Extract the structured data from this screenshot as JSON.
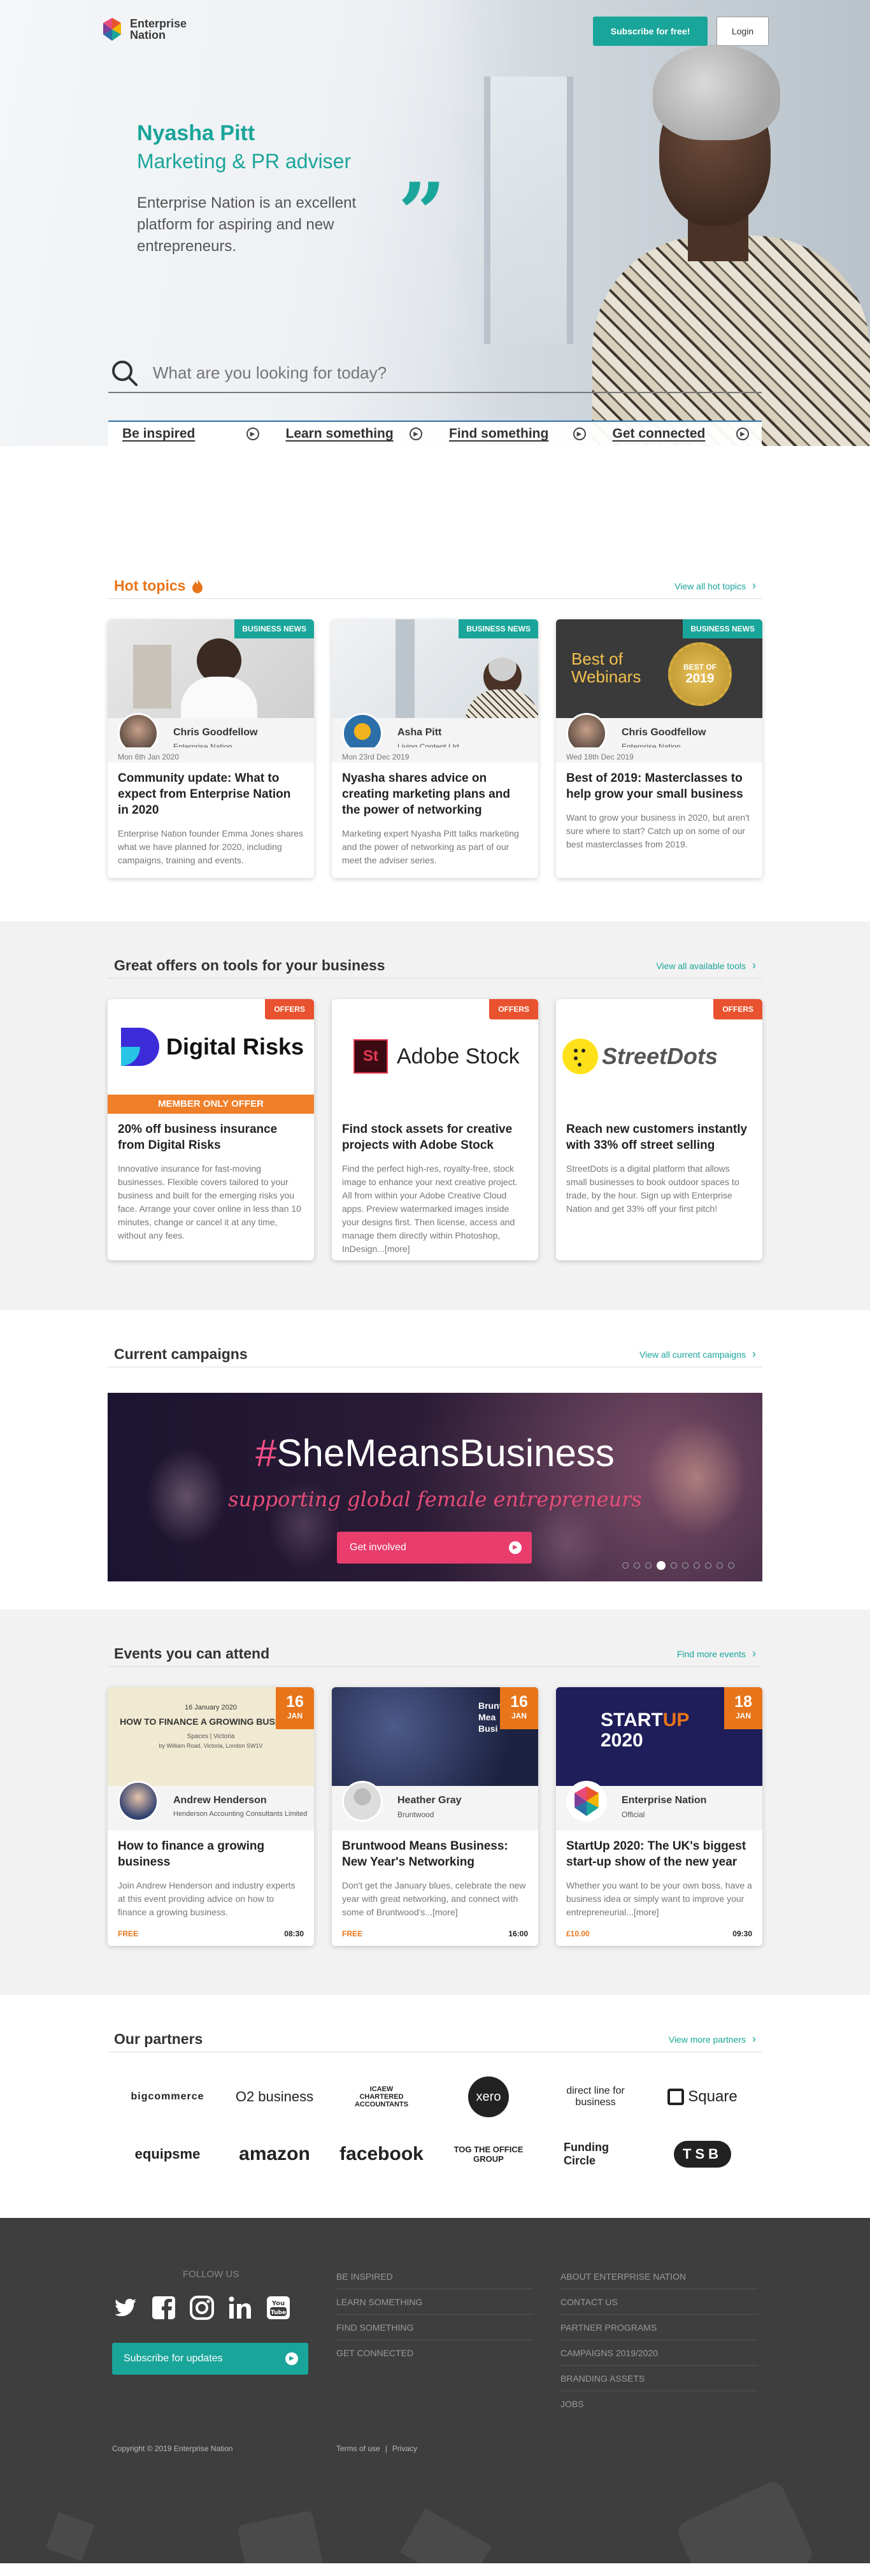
{
  "brand": {
    "name_line1": "Enterprise",
    "name_line2": "Nation"
  },
  "header": {
    "subscribe_label": "Subscribe for free!",
    "login_label": "Login"
  },
  "hero": {
    "name": "Nyasha Pitt",
    "role": "Marketing & PR adviser",
    "quote": "Enterprise Nation is an excellent platform for aspiring and new entrepreneurs.",
    "search_placeholder": "What are you looking for today?",
    "nav": [
      {
        "label": "Be inspired"
      },
      {
        "label": "Learn something"
      },
      {
        "label": "Find something"
      },
      {
        "label": "Get connected"
      }
    ]
  },
  "hot_topics": {
    "title": "Hot topics",
    "link": "View all hot topics",
    "cards": [
      {
        "tag": "BUSINESS NEWS",
        "author": "Chris Goodfellow",
        "org": "Enterprise Nation",
        "date": "Mon 6th Jan 2020",
        "title": "Community update: What to expect from Enterprise Nation in 2020",
        "desc": "Enterprise Nation founder Emma Jones shares what we have planned for 2020, including campaigns, training and events."
      },
      {
        "tag": "BUSINESS NEWS",
        "author": "Asha Pitt",
        "org": "Living Content Ltd",
        "date": "Mon 23rd Dec 2019",
        "title": "Nyasha shares advice on creating marketing plans and the power of networking",
        "desc": "Marketing expert Nyasha Pitt talks marketing and the power of networking as part of our meet the adviser series."
      },
      {
        "tag": "BUSINESS NEWS",
        "author": "Chris Goodfellow",
        "org": "Enterprise Nation",
        "date": "Wed 18th Dec 2019",
        "title": "Best of 2019: Masterclasses to help grow your small business",
        "desc": "Want to grow your business in 2020, but aren't sure where to start? Catch up on some of our best masterclasses from 2019.",
        "img_text_1": "Best of",
        "img_text_2": "Webinars",
        "seal_1": "BEST OF",
        "seal_2": "2019"
      }
    ]
  },
  "offers": {
    "title": "Great offers on tools for your business",
    "link": "View all available tools",
    "cards": [
      {
        "tag": "OFFERS",
        "brand": "Digital Risks",
        "band": "MEMBER ONLY OFFER",
        "title": "20% off business insurance from Digital Risks",
        "desc": "Innovative insurance for fast-moving businesses. Flexible covers tailored to your business and built for the emerging risks you face. Arrange your cover online in less than 10 minutes, change or cancel it at any time, without any fees."
      },
      {
        "tag": "OFFERS",
        "brand": "Adobe Stock",
        "badge": "St",
        "title": "Find stock assets for creative projects with Adobe Stock",
        "desc": "Find the perfect high-res, royalty-free, stock image to enhance your next creative project. All from within your Adobe Creative Cloud apps. Preview watermarked images inside your designs first. Then license, access and manage them directly within Photoshop, InDesign...[more]"
      },
      {
        "tag": "OFFERS",
        "brand": "StreetDots",
        "title": "Reach new customers instantly with 33% off street selling",
        "desc": "StreetDots is a digital platform that allows small businesses to book outdoor spaces to trade, by the hour. Sign up with Enterprise Nation and get 33% off your first pitch!"
      }
    ]
  },
  "campaigns": {
    "title": "Current campaigns",
    "link": "View all current campaigns",
    "banner_hash": "#",
    "banner_title": "SheMeansBusiness",
    "banner_sub": "supporting global female entrepreneurs",
    "cta": "Get involved",
    "slides": 10,
    "active_slide": 3
  },
  "events": {
    "title": "Events you can attend",
    "link": "Find more events",
    "cards": [
      {
        "day": "16",
        "month": "JAN",
        "author": "Andrew Henderson",
        "org": "Henderson Accounting Consultants Limited",
        "title": "How to finance a growing business",
        "desc": "Join Andrew Henderson and industry experts at this event providing advice on how to finance a growing business.",
        "price": "FREE",
        "time": "08:30",
        "img_date": "16 January 2020",
        "img_title": "HOW TO FINANCE A GROWING BUSINESS",
        "img_sub": "Spaces | Victoria",
        "img_host": "by William Road, Victoria, London SW1V"
      },
      {
        "day": "16",
        "month": "JAN",
        "author": "Heather Gray",
        "org": "Bruntwood",
        "title": "Bruntwood Means Business: New Year's Networking",
        "desc": "Don't get the January blues, celebrate the new year with great networking, and connect with some of Bruntwood's...[more]",
        "price": "FREE",
        "time": "16:00",
        "img_title": "Brunt Mea Busi"
      },
      {
        "day": "18",
        "month": "JAN",
        "author": "Enterprise Nation",
        "org": "Official",
        "title": "StartUp 2020: The UK's biggest start-up show of the new year",
        "desc": "Whether you want to be your own boss, have a business idea or simply want to improve your entrepreneurial...[more]",
        "price": "£10.00",
        "time": "09:30",
        "img_start": "START",
        "img_up": "UP",
        "img_year": "2020"
      }
    ]
  },
  "partners": {
    "title": "Our partners",
    "link": "View more partners",
    "logos": [
      "bigcommerce",
      "O2 business",
      "ICAEW CHARTERED ACCOUNTANTS",
      "xero",
      "direct line for business",
      "Square",
      "equipsme",
      "amazon",
      "facebook",
      "TOG THE OFFICE GROUP",
      "Funding Circle",
      "TSB"
    ]
  },
  "footer": {
    "follow": "FOLLOW US",
    "socials": [
      "twitter-icon",
      "facebook-icon",
      "instagram-icon",
      "linkedin-icon",
      "youtube-icon"
    ],
    "updates": "Subscribe for updates",
    "col1": [
      "BE INSPIRED",
      "LEARN SOMETHING",
      "FIND SOMETHING",
      "GET CONNECTED"
    ],
    "col2": [
      "ABOUT ENTERPRISE NATION",
      "CONTACT US",
      "PARTNER PROGRAMS",
      "CAMPAIGNS 2019/2020",
      "BRANDING ASSETS",
      "JOBS"
    ],
    "copyright": "Copyright © 2019 Enterprise Nation",
    "terms": "Terms of use",
    "sep": "|",
    "privacy": "Privacy"
  },
  "colors": {
    "teal": "#1aa59a",
    "orange": "#e8751a",
    "offer_red": "#e8522e",
    "pink": "#e83d6d",
    "footer_bg": "#3e3e3e"
  }
}
